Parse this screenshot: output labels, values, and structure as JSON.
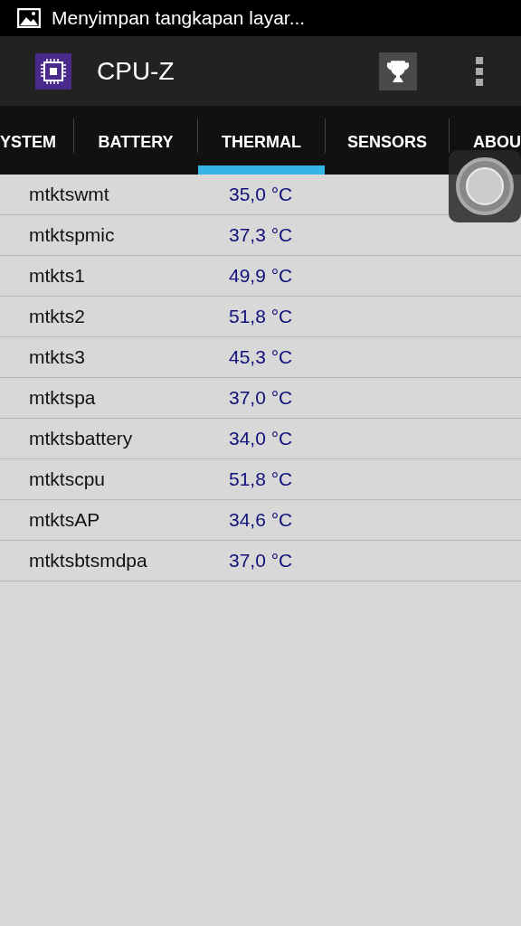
{
  "status_bar": {
    "notification": "Menyimpan tangkapan layar..."
  },
  "app_bar": {
    "title": "CPU-Z"
  },
  "tabs": [
    {
      "label": "YSTEM",
      "selected": false
    },
    {
      "label": "BATTERY",
      "selected": false
    },
    {
      "label": "THERMAL",
      "selected": true
    },
    {
      "label": "SENSORS",
      "selected": false
    },
    {
      "label": "ABOU",
      "selected": false
    }
  ],
  "rows": [
    {
      "name": "mtktswmt",
      "value": "35,0 °C"
    },
    {
      "name": "mtktspmic",
      "value": "37,3 °C"
    },
    {
      "name": "mtkts1",
      "value": "49,9 °C"
    },
    {
      "name": "mtkts2",
      "value": "51,8 °C"
    },
    {
      "name": "mtkts3",
      "value": "45,3 °C"
    },
    {
      "name": "mtktspa",
      "value": "37,0 °C"
    },
    {
      "name": "mtktsbattery",
      "value": "34,0 °C"
    },
    {
      "name": "mtktscpu",
      "value": "51,8 °C"
    },
    {
      "name": "mtktsAP",
      "value": "34,6 °C"
    },
    {
      "name": "mtktsbtsmdpa",
      "value": "37,0 °C"
    }
  ]
}
